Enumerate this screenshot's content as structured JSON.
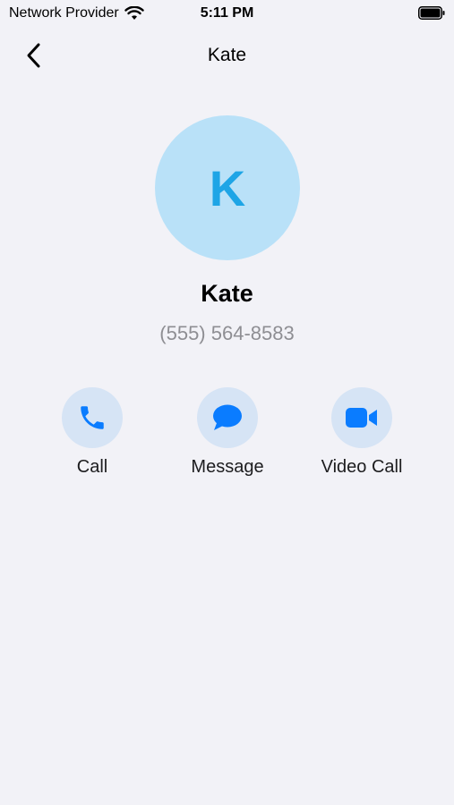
{
  "status_bar": {
    "carrier": "Network Provider",
    "time": "5:11 PM",
    "wifi_icon": "wifi-icon",
    "battery_icon": "battery-icon"
  },
  "nav": {
    "back_icon": "chevron-left-icon",
    "title": "Kate"
  },
  "contact": {
    "initial": "K",
    "name": "Kate",
    "phone": "(555) 564-8583"
  },
  "actions": [
    {
      "label": "Call",
      "icon": "phone-icon"
    },
    {
      "label": "Message",
      "icon": "message-bubble-icon"
    },
    {
      "label": "Video Call",
      "icon": "video-camera-icon"
    }
  ],
  "colors": {
    "background": "#f2f2f7",
    "avatar_bg": "#b9e1f8",
    "avatar_text": "#1ea5e6",
    "action_bg": "#d6e4f5",
    "accent": "#0a7cff",
    "secondary_text": "#8e8e93"
  }
}
